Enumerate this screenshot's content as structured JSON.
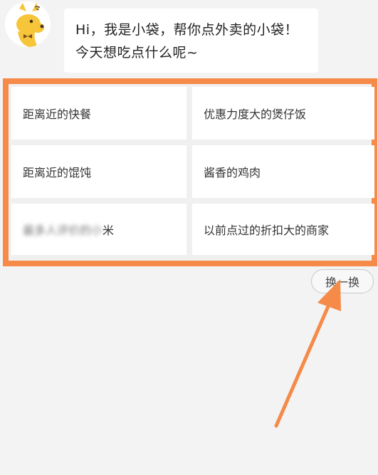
{
  "chat": {
    "greeting": "Hi，我是小袋，帮你点外卖的小袋！今天想吃点什么呢~"
  },
  "suggestions": {
    "items": [
      {
        "label": "距离近的快餐"
      },
      {
        "label": "优惠力度大的煲仔饭"
      },
      {
        "label": "距离近的馄饨"
      },
      {
        "label": "酱香的鸡肉"
      },
      {
        "label_blurred": "最多人评价的小",
        "label_tail": "米"
      },
      {
        "label": "以前点过的折扣大的商家"
      }
    ]
  },
  "refresh": {
    "label": "换一换"
  },
  "colors": {
    "highlight_border": "#f58a49",
    "arrow": "#f58a49",
    "mascot": "#f6c53a"
  },
  "icons": {
    "avatar": "kangaroo-mascot-icon",
    "annotation": "annotation-arrow-icon"
  }
}
